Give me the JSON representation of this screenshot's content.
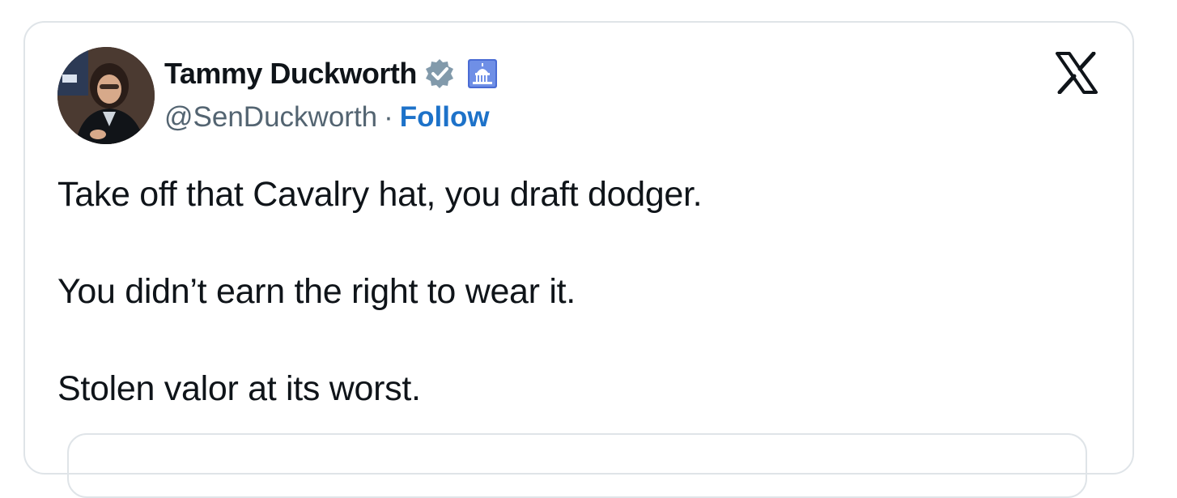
{
  "author": {
    "name": "Tammy Duckworth",
    "handle": "@SenDuckworth",
    "separator": "·",
    "follow_label": "Follow"
  },
  "badges": {
    "verified": "verified-badge-icon",
    "government": "us-capitol-icon"
  },
  "tweet": {
    "lines": [
      "Take off that Cavalry hat, you draft dodger.",
      "You didn’t earn the right to wear it.",
      "Stolen valor at its worst."
    ]
  },
  "colors": {
    "follow": "#1d72c9",
    "text": "#0f1419",
    "secondary": "#536471",
    "border": "#dfe4e8",
    "verified": "#829aab",
    "gov_badge": "#4a6cd4"
  }
}
